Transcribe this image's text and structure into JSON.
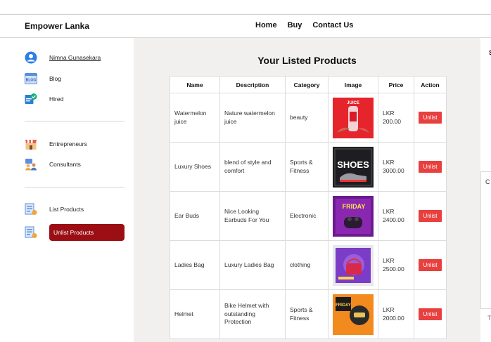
{
  "header": {
    "brand": "Empower Lanka",
    "nav": [
      "Home",
      "Buy",
      "Contact Us"
    ]
  },
  "sidebar": {
    "user_name": "Nimna Gunasekara",
    "items_top": [
      "Blog",
      "Hired"
    ],
    "items_mid": [
      "Entrepreneurs",
      "Consultants"
    ],
    "items_bottom": [
      "List Products"
    ],
    "active_item": "Unlist Products",
    "icon_badge": "BLOG"
  },
  "main": {
    "title": "Your Listed Products",
    "columns": [
      "Name",
      "Description",
      "Category",
      "Image",
      "Price",
      "Action"
    ],
    "action_label": "Unlist",
    "rows": [
      {
        "name": "Watermelon juice",
        "description": "Nature watermelon juice",
        "category": "beauty",
        "price": "LKR 200.00",
        "image": "watermelon-juice-ad",
        "thumb_text": "JUICE"
      },
      {
        "name": "Luxury Shoes",
        "description": "blend of style and comfort",
        "category": "Sports & Fitness",
        "price": "LKR 3000.00",
        "image": "shoes-ad",
        "thumb_text": "SHOES"
      },
      {
        "name": "Ear Buds",
        "description": "Nice Looking Earbuds For You",
        "category": "Electronic",
        "price": "LKR 2400.00",
        "image": "earbuds-ad",
        "thumb_text": "FRIDAY"
      },
      {
        "name": "Ladies Bag",
        "description": "Luxury Ladies Bag",
        "category": "clothing",
        "price": "LKR 2500.00",
        "image": "ladies-bag-ad",
        "thumb_text": ""
      },
      {
        "name": "Helmet",
        "description": "Bike Helmet with outstanding Protection",
        "category": "Sports & Fitness",
        "price": "LKR 2000.00",
        "image": "helmet-ad",
        "thumb_text": "FRIDAY"
      }
    ]
  },
  "right_panel": {
    "letter_top": "S",
    "letter_box": "C",
    "letter_bottom": "T"
  },
  "colors": {
    "active_bg": "#9b0f14",
    "unlist_bg": "#e83f3f",
    "main_bg": "#f1f0ef"
  }
}
